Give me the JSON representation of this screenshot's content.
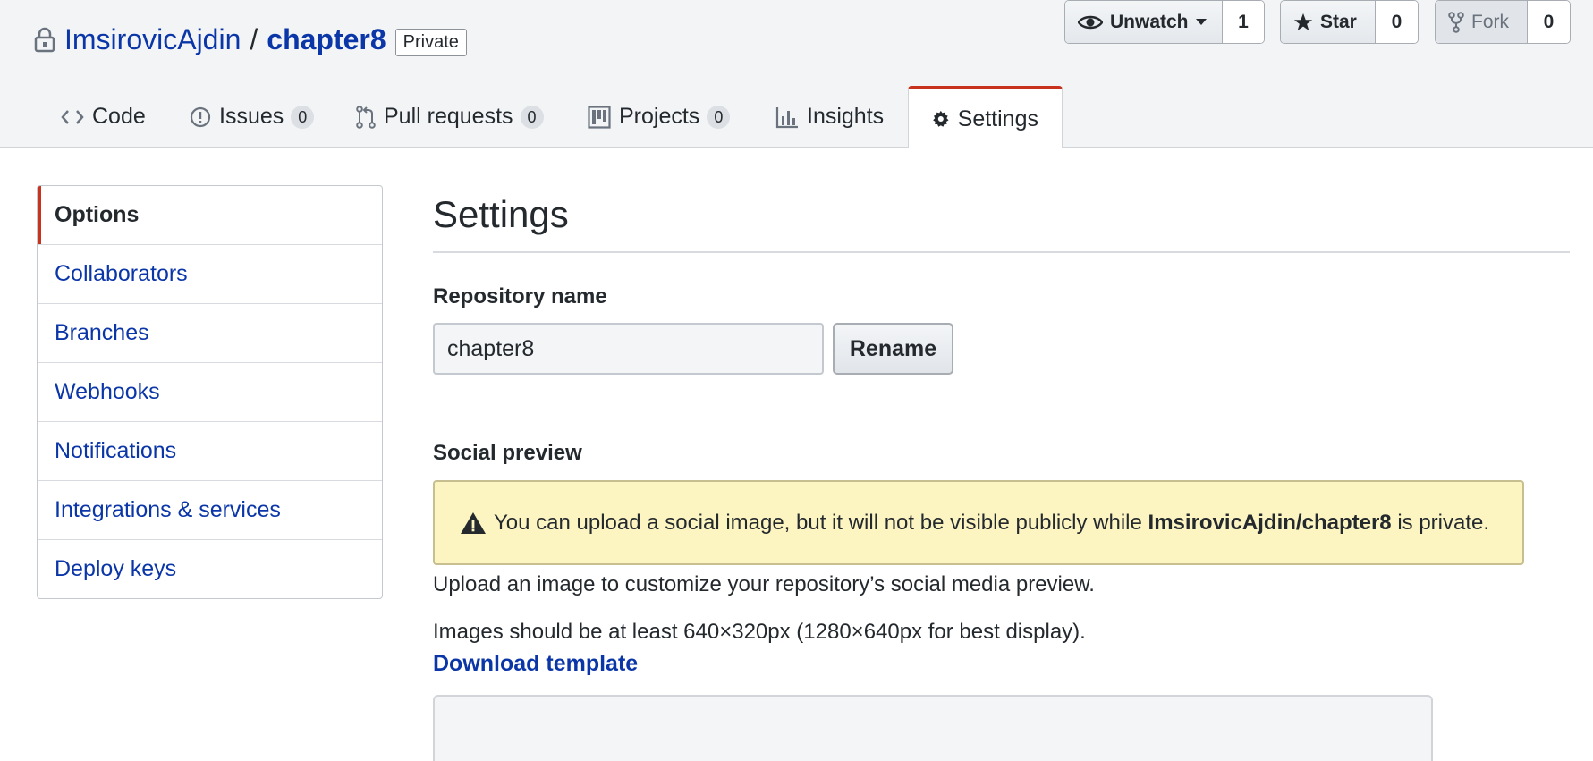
{
  "header": {
    "owner": "ImsirovicAjdin",
    "separator": "/",
    "repo": "chapter8",
    "visibility": "Private",
    "actions": {
      "watch": {
        "label": "Unwatch",
        "count": "1"
      },
      "star": {
        "label": "Star",
        "count": "0"
      },
      "fork": {
        "label": "Fork",
        "count": "0"
      }
    }
  },
  "tabs": {
    "code": {
      "label": "Code"
    },
    "issues": {
      "label": "Issues",
      "count": "0"
    },
    "pulls": {
      "label": "Pull requests",
      "count": "0"
    },
    "projects": {
      "label": "Projects",
      "count": "0"
    },
    "insights": {
      "label": "Insights"
    },
    "settings": {
      "label": "Settings"
    }
  },
  "sidebar": {
    "items": [
      {
        "label": "Options"
      },
      {
        "label": "Collaborators"
      },
      {
        "label": "Branches"
      },
      {
        "label": "Webhooks"
      },
      {
        "label": "Notifications"
      },
      {
        "label": "Integrations & services"
      },
      {
        "label": "Deploy keys"
      }
    ]
  },
  "main": {
    "title": "Settings",
    "repo_name_label": "Repository name",
    "repo_name_value": "chapter8",
    "rename_label": "Rename",
    "social_label": "Social preview",
    "flash_pre": "You can upload a social image, but it will not be visible publicly while",
    "flash_repo": "ImsirovicAjdin/chapter8",
    "flash_post": "is private.",
    "note_upload": "Upload an image to customize your repository’s social media preview.",
    "note_size": "Images should be at least 640×320px (1280×640px for best display).",
    "download_label": "Download template"
  },
  "colors": {
    "link": "#0b36a8",
    "accent": "#c8331f",
    "flash_bg": "#fcf5c2"
  },
  "icons": [
    "lock-icon",
    "eye-icon",
    "star-icon",
    "fork-icon",
    "code-icon",
    "issue-icon",
    "pull-request-icon",
    "project-icon",
    "graph-icon",
    "gear-icon",
    "alert-icon"
  ]
}
